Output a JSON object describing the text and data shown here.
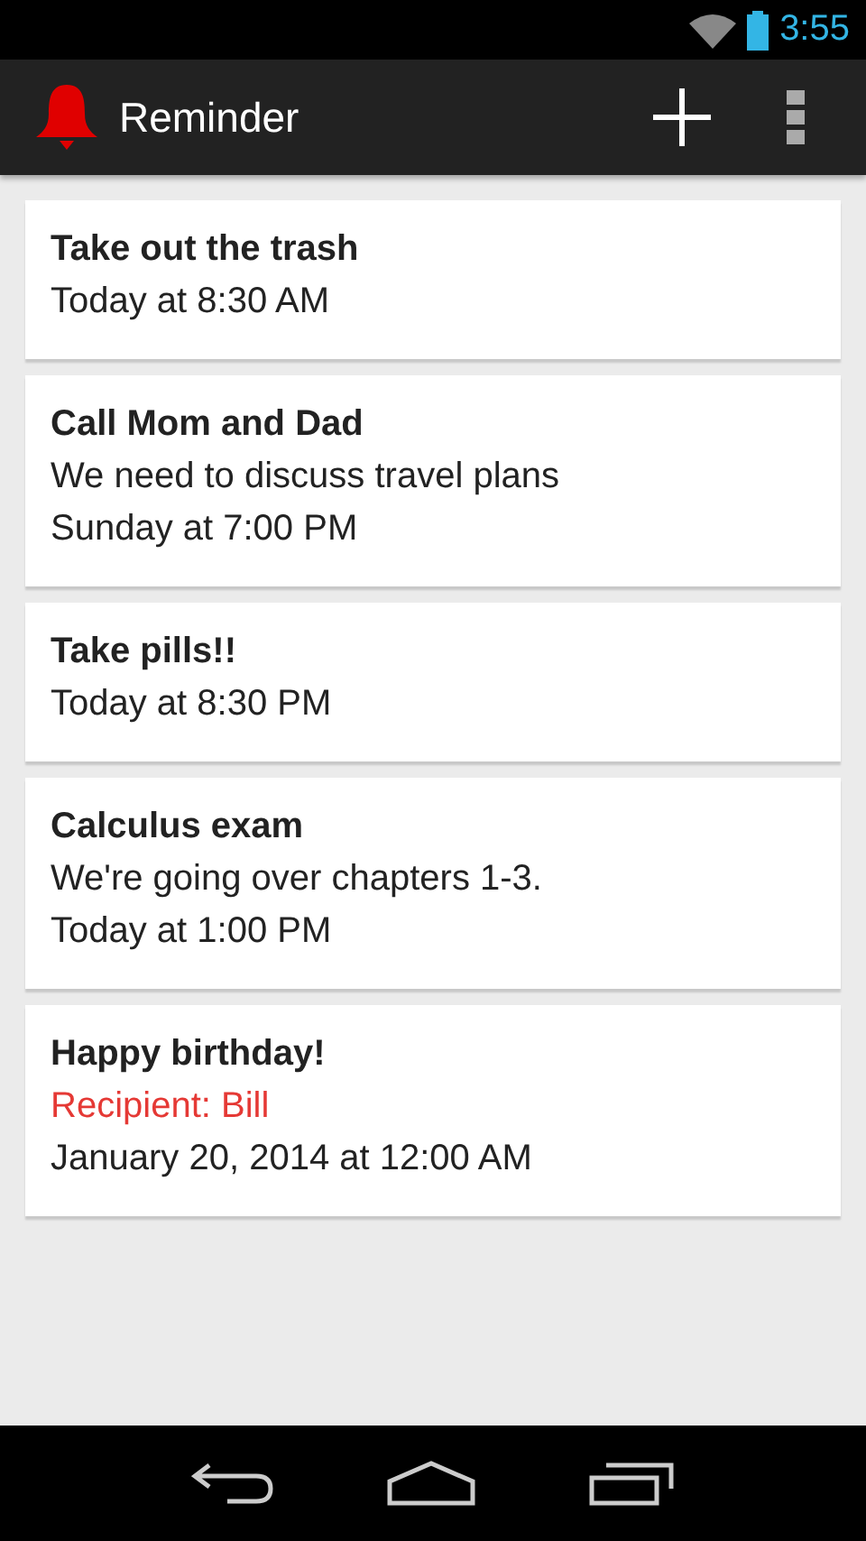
{
  "status_bar": {
    "time": "3:55"
  },
  "action_bar": {
    "title": "Reminder"
  },
  "reminders": [
    {
      "title": "Take out the trash",
      "lines": [
        {
          "kind": "time",
          "text": "Today at 8:30 AM"
        }
      ]
    },
    {
      "title": "Call Mom and Dad",
      "lines": [
        {
          "kind": "note",
          "text": "We need to discuss travel plans"
        },
        {
          "kind": "time",
          "text": "Sunday at 7:00 PM"
        }
      ]
    },
    {
      "title": "Take pills!!",
      "lines": [
        {
          "kind": "time",
          "text": "Today at 8:30 PM"
        }
      ]
    },
    {
      "title": "Calculus exam",
      "lines": [
        {
          "kind": "note",
          "text": "We're going over chapters 1-3."
        },
        {
          "kind": "time",
          "text": "Today at 1:00 PM"
        }
      ]
    },
    {
      "title": "Happy birthday!",
      "lines": [
        {
          "kind": "recipient",
          "text": "Recipient: Bill"
        },
        {
          "kind": "time",
          "text": "January 20, 2014 at 12:00 AM"
        }
      ]
    }
  ]
}
